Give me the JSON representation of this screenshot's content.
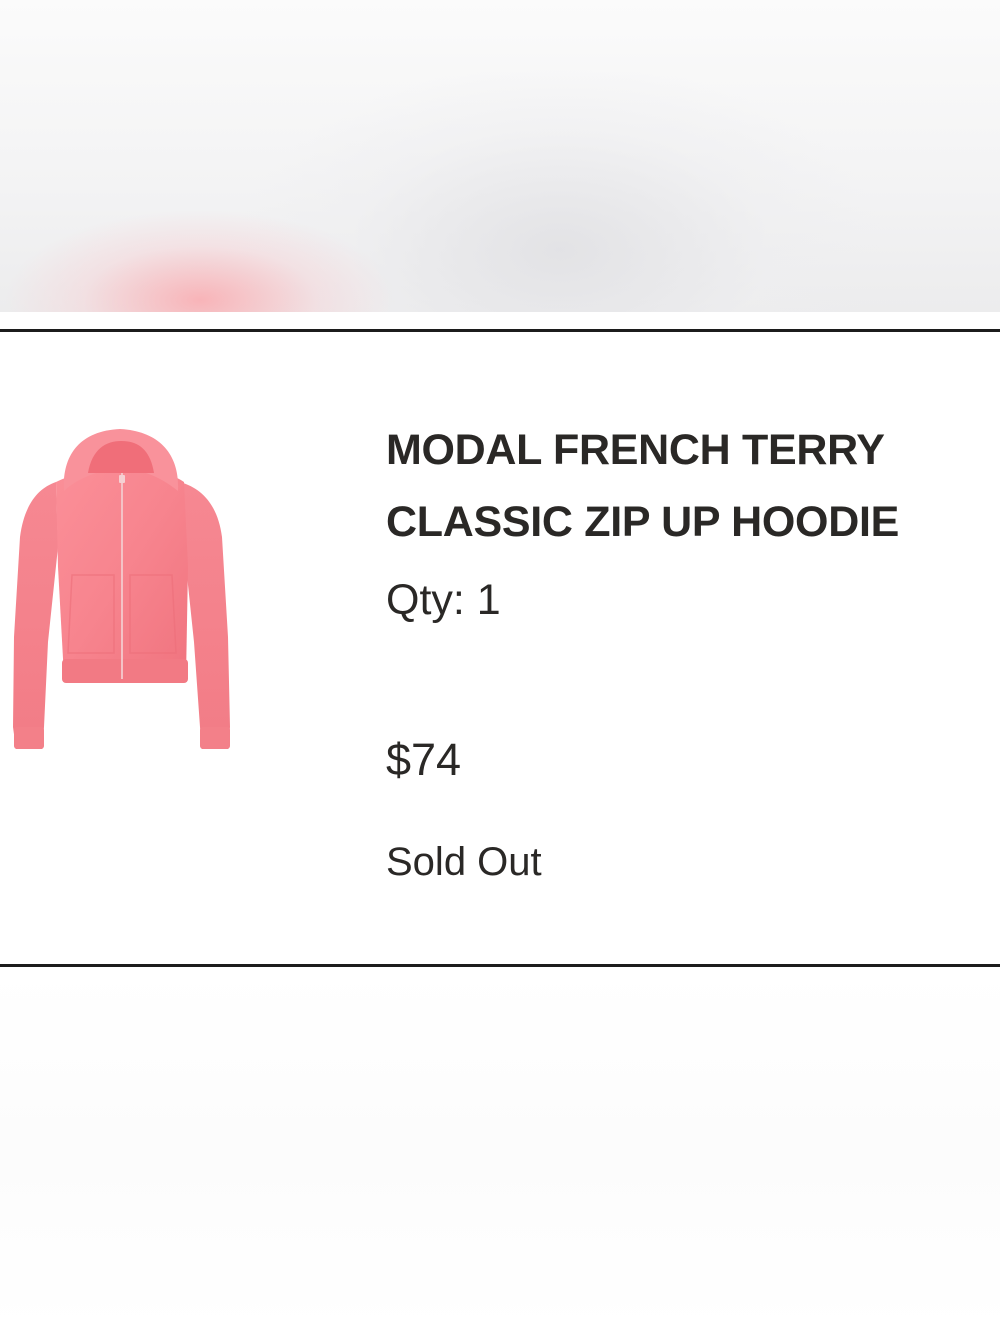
{
  "cart_item": {
    "title_line1": "MODAL FRENCH TERRY",
    "title_line2": "CLASSIC ZIP UP HOODIE",
    "quantity_label": "Qty: 1",
    "price": "$74",
    "status": "Sold Out",
    "image": {
      "icon": "pink-zip-hoodie-image",
      "color": "#f7848e"
    }
  },
  "colors": {
    "text": "#2a2826",
    "divider": "#1c1c1c",
    "background": "#ffffff"
  }
}
